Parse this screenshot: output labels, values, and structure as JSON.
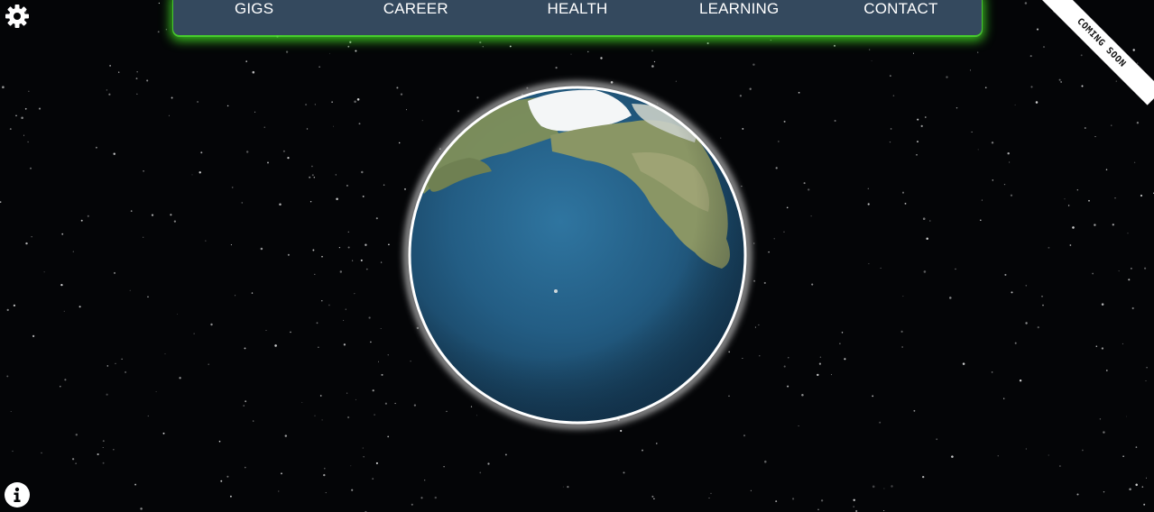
{
  "nav": {
    "items": [
      {
        "label": "GIGS"
      },
      {
        "label": "CAREER"
      },
      {
        "label": "HEALTH"
      },
      {
        "label": "LEARNING"
      },
      {
        "label": "CONTACT"
      }
    ]
  },
  "ribbon": {
    "label": "COMING SOON"
  },
  "icons": {
    "settings": "gear-icon",
    "info": "info-icon"
  },
  "colors": {
    "background": "#040507",
    "nav_background": "#34495e",
    "nav_glow": "#46e628",
    "ocean": "#245f85",
    "ribbon": "#ffffff"
  }
}
